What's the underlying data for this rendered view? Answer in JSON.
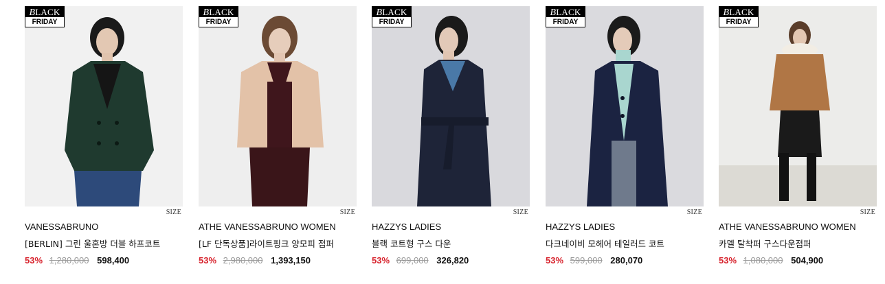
{
  "badge": {
    "top_mark": "B",
    "top_text": "LACK",
    "bottom": "FRIDAY"
  },
  "size_label": "SIZE",
  "products": [
    {
      "brand": "VANESSABRUNO",
      "name": "[BERLIN] 그린 울혼방 더블 하프코트",
      "discount": "53%",
      "original_price": "1,280,000",
      "price": "598,400"
    },
    {
      "brand": "ATHE VANESSABRUNO WOMEN",
      "name": "[LF 단독상품]라이트핑크 양모피 점퍼",
      "discount": "53%",
      "original_price": "2,980,000",
      "price": "1,393,150"
    },
    {
      "brand": "HAZZYS LADIES",
      "name": "블랙 코트형 구스 다운",
      "discount": "53%",
      "original_price": "699,000",
      "price": "326,820"
    },
    {
      "brand": "HAZZYS LADIES",
      "name": "다크네이비 모헤어 테일러드 코트",
      "discount": "53%",
      "original_price": "599,000",
      "price": "280,070"
    },
    {
      "brand": "ATHE VANESSABRUNO WOMEN",
      "name": "카멜 탈착퍼 구스다운점퍼",
      "discount": "53%",
      "original_price": "1,080,000",
      "price": "504,900"
    }
  ]
}
